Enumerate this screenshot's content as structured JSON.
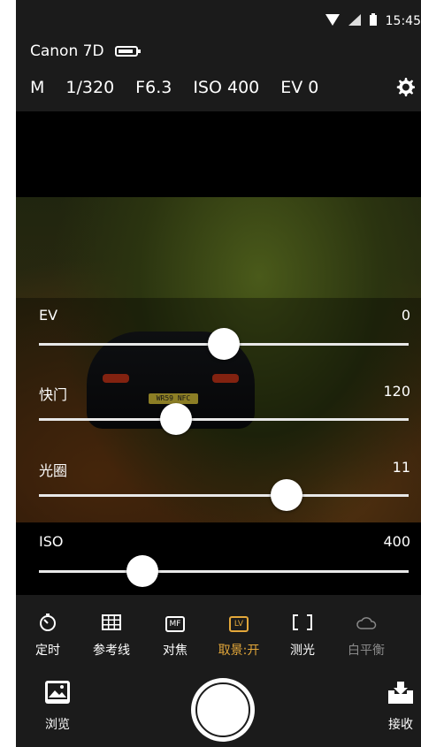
{
  "status": {
    "time": "15:45"
  },
  "camera": {
    "name": "Canon 7D",
    "mode": "M",
    "shutter": "1/320",
    "aperture": "F6.3",
    "iso": "ISO 400",
    "ev": "EV 0"
  },
  "preview": {
    "plate_text": "WR59 NFC"
  },
  "sliders": [
    {
      "label": "EV",
      "value": "0",
      "level": 0.5
    },
    {
      "label": "快门",
      "value": "120",
      "level": 0.37
    },
    {
      "label": "光圈",
      "value": "11",
      "level": 0.67
    },
    {
      "label": "ISO",
      "value": "400",
      "level": 0.28
    }
  ],
  "tools": [
    {
      "label": "定时",
      "icon": "timer-icon"
    },
    {
      "label": "参考线",
      "icon": "grid-icon"
    },
    {
      "label": "对焦",
      "icon": "manual-focus-icon"
    },
    {
      "label": "取景:开",
      "icon": "live-view-icon",
      "active": true
    },
    {
      "label": "测光",
      "icon": "metering-icon"
    },
    {
      "label": "白平衡",
      "icon": "white-balance-icon"
    }
  ],
  "bottom": {
    "browse_label": "浏览",
    "receive_label": "接收",
    "mf_text": "MF",
    "lv_text": "LV"
  },
  "colors": {
    "accent": "#e3a73a",
    "panel": "#1b1b1b",
    "muted": "#8a8a8a"
  }
}
